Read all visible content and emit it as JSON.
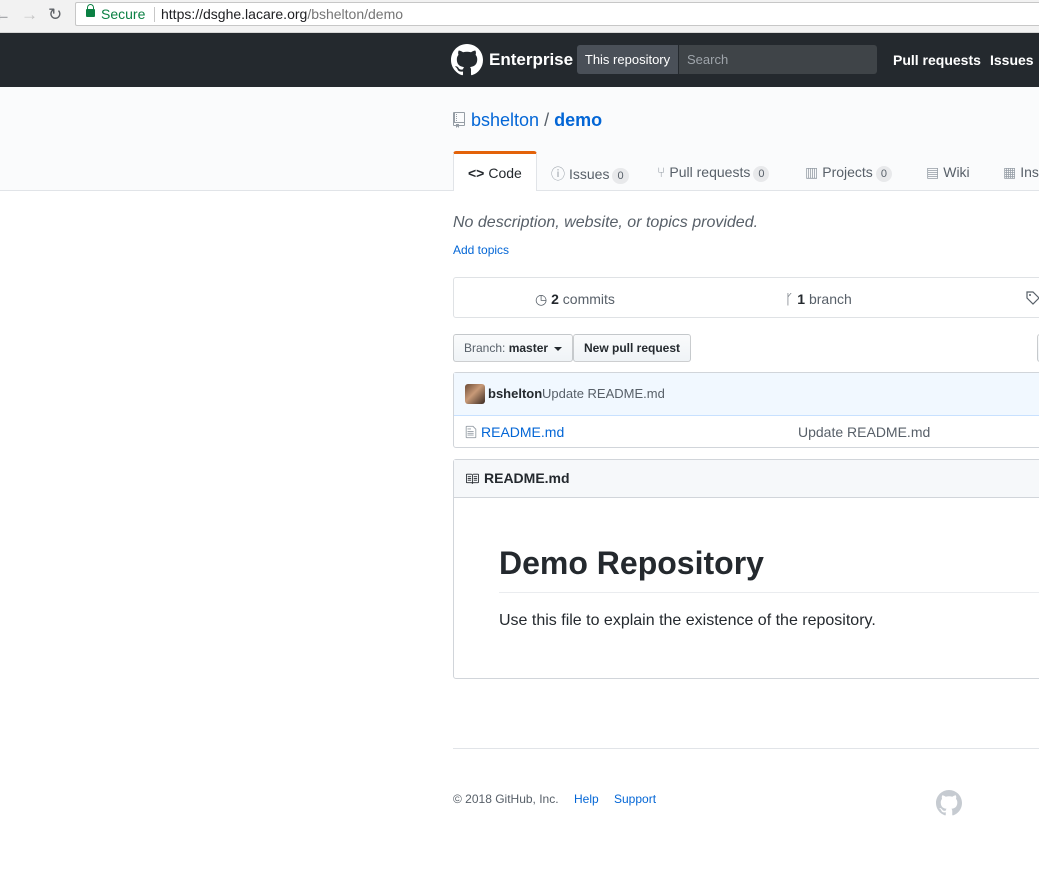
{
  "browser": {
    "secure_label": "Secure",
    "url_host": "https://dsghe.lacare.org",
    "url_path": "/bshelton/demo"
  },
  "header": {
    "brand": "Enterprise",
    "scope_label": "This repository",
    "search_placeholder": "Search",
    "nav": [
      "Pull requests",
      "Issues"
    ]
  },
  "repo": {
    "owner": "bshelton",
    "separator": "/",
    "name": "demo",
    "tabs": [
      {
        "label": "Code",
        "icon": "code-icon"
      },
      {
        "label": "Issues",
        "count": "0",
        "icon": "issue-icon"
      },
      {
        "label": "Pull requests",
        "count": "0",
        "icon": "pull-request-icon"
      },
      {
        "label": "Projects",
        "count": "0",
        "icon": "project-icon"
      },
      {
        "label": "Wiki",
        "icon": "book-icon"
      },
      {
        "label": "Ins",
        "icon": "graph-icon"
      }
    ],
    "description": "No description, website, or topics provided.",
    "add_topics": "Add topics"
  },
  "summary": {
    "commits_count": "2",
    "commits_label": "commits",
    "branch_count": "1",
    "branch_label": "branch"
  },
  "toolbar": {
    "branch_prefix": "Branch:",
    "branch_name": "master",
    "new_pr": "New pull request"
  },
  "latest_commit": {
    "author": "bshelton",
    "message": "Update README.md"
  },
  "files": [
    {
      "name": "README.md",
      "message": "Update README.md"
    }
  ],
  "readme": {
    "filename": "README.md",
    "heading": "Demo Repository",
    "body": "Use this file to explain the existence of the repository."
  },
  "footer": {
    "copyright": "© 2018 GitHub, Inc.",
    "links": [
      "Help",
      "Support"
    ]
  },
  "colors": {
    "header_bg": "#24292e",
    "link": "#0366d6",
    "selected_tab_accent": "#e36209"
  }
}
